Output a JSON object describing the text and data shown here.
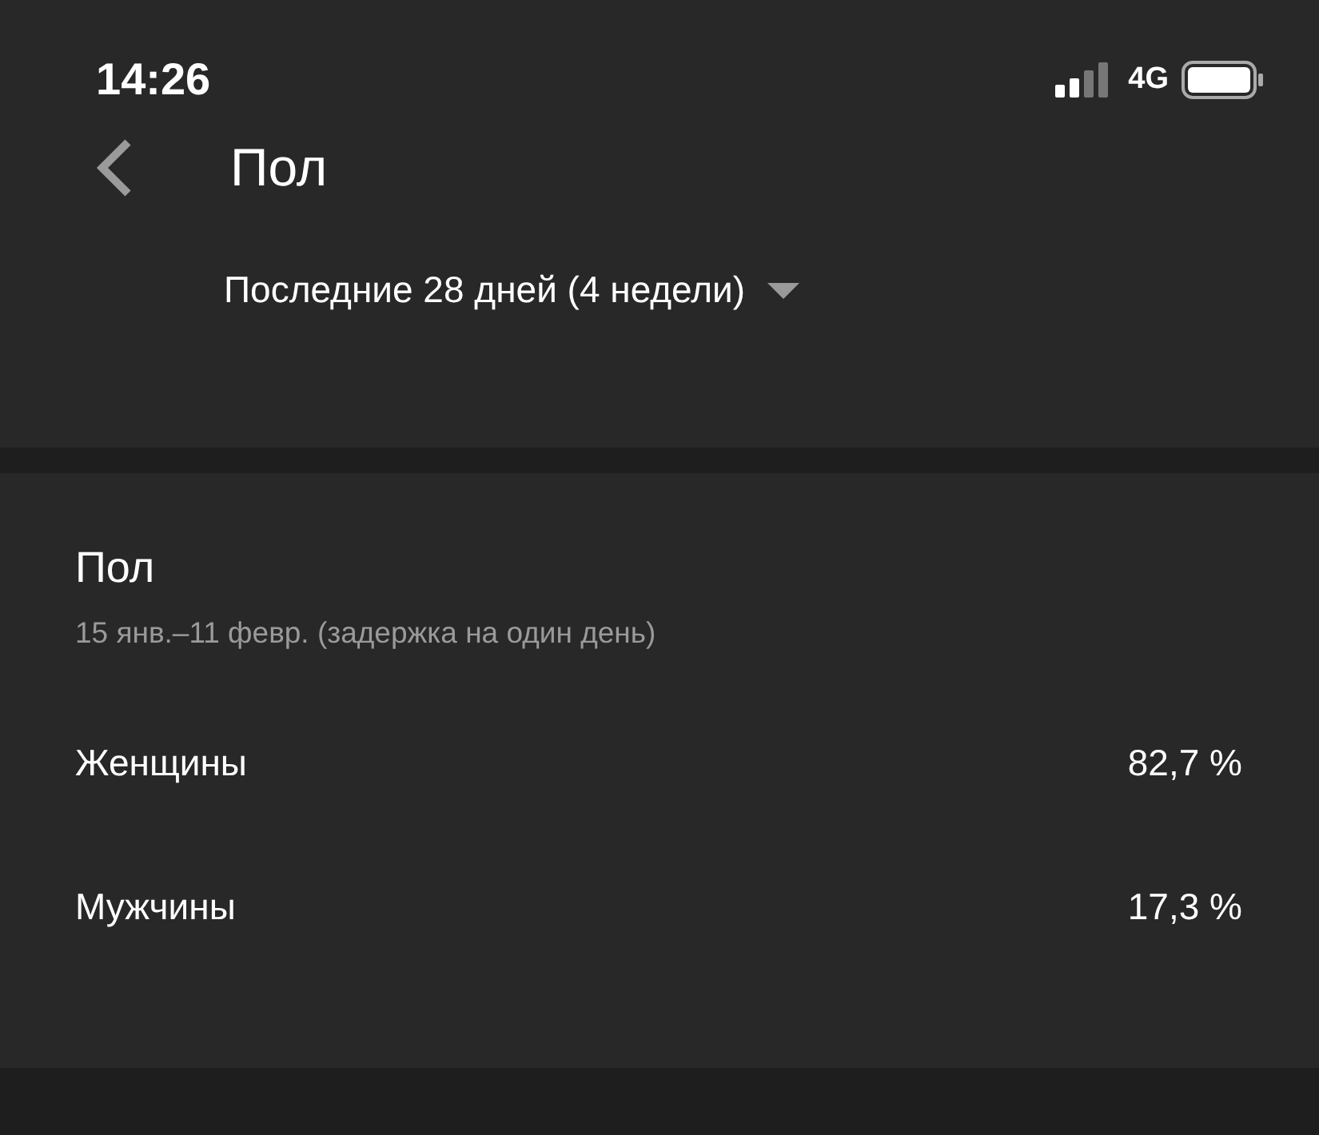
{
  "status_bar": {
    "time": "14:26",
    "network": "4G"
  },
  "header": {
    "title": "Пол",
    "period": "Последние 28 дней (4 недели)"
  },
  "card": {
    "title": "Пол",
    "subtitle": "15 янв.–11 февр. (задержка на один день)",
    "rows": [
      {
        "label": "Женщины",
        "value": "82,7 %"
      },
      {
        "label": "Мужчины",
        "value": "17,3 %"
      }
    ]
  }
}
